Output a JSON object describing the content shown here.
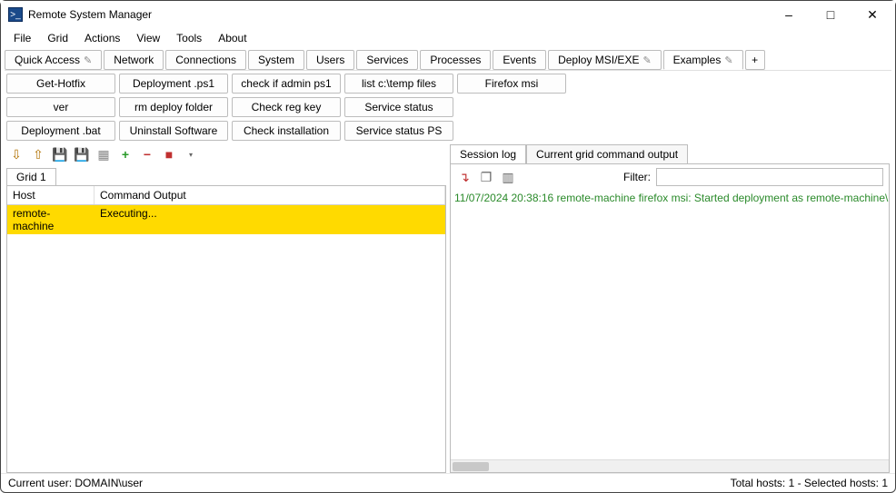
{
  "window": {
    "title": "Remote System Manager"
  },
  "menu": {
    "file": "File",
    "grid": "Grid",
    "actions": "Actions",
    "view": "View",
    "tools": "Tools",
    "about": "About"
  },
  "tabs": {
    "quick_access": "Quick Access",
    "network": "Network",
    "connections": "Connections",
    "system": "System",
    "users": "Users",
    "services": "Services",
    "processes": "Processes",
    "events": "Events",
    "deploy": "Deploy MSI/EXE",
    "examples": "Examples",
    "add": "+"
  },
  "cmds": {
    "r0": [
      "Get-Hotfix",
      "Deployment .ps1",
      "check if admin ps1",
      "list c:\\temp files",
      "Firefox msi"
    ],
    "r1": [
      "ver",
      "rm deploy folder",
      "Check reg key",
      "Service status"
    ],
    "r2": [
      "Deployment .bat",
      "Uninstall Software",
      "Check installation",
      "Service status PS"
    ]
  },
  "grid": {
    "tab": "Grid 1",
    "headers": {
      "host": "Host",
      "cmd": "Command Output"
    },
    "rows": [
      {
        "host": "remote-machine",
        "output": "Executing..."
      }
    ]
  },
  "right": {
    "tab_session": "Session log",
    "tab_output": "Current grid command output",
    "filter_label": "Filter:",
    "filter_value": "",
    "log": [
      "11/07/2024 20:38:16 remote-machine firefox msi: Started deployment as remote-machine\\"
    ]
  },
  "status": {
    "left": "Current user: DOMAIN\\user",
    "right": "Total hosts: 1 - Selected hosts: 1"
  }
}
